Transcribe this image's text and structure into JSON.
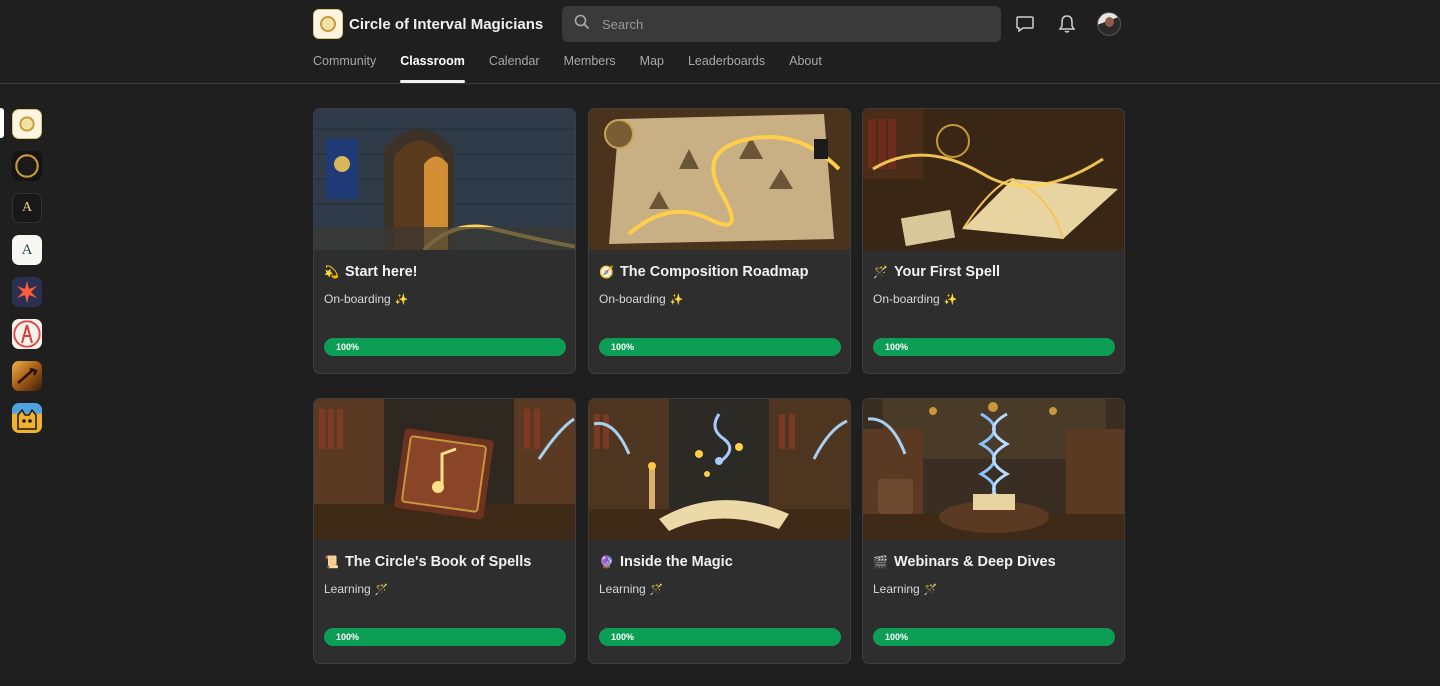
{
  "app": {
    "community_name": "Circle of Interval Magicians",
    "search_placeholder": "Search"
  },
  "tabs": [
    {
      "label": "Community",
      "active": false
    },
    {
      "label": "Classroom",
      "active": true
    },
    {
      "label": "Calendar",
      "active": false
    },
    {
      "label": "Members",
      "active": false
    },
    {
      "label": "Map",
      "active": false
    },
    {
      "label": "Leaderboards",
      "active": false
    },
    {
      "label": "About",
      "active": false
    }
  ],
  "sidebar": {
    "items": [
      {
        "icon": "interval-magicians-logo",
        "label": "",
        "selected": true
      },
      {
        "icon": "treble-clef-logo",
        "label": ""
      },
      {
        "icon": "letter-a-dark-logo",
        "label": "A"
      },
      {
        "icon": "letter-a-light-logo",
        "label": "A"
      },
      {
        "icon": "star-burst-logo",
        "label": ""
      },
      {
        "icon": "red-emblem-logo",
        "label": ""
      },
      {
        "icon": "orange-guitar-logo",
        "label": ""
      },
      {
        "icon": "cat-logo",
        "label": ""
      }
    ]
  },
  "courses": [
    {
      "emoji": "💫",
      "title": "Start here!",
      "subtitle": "On-boarding",
      "subtitle_emoji": "✨",
      "progress_label": "100%",
      "progress": 100
    },
    {
      "emoji": "🧭",
      "title": "The Composition Roadmap",
      "subtitle": "On-boarding",
      "subtitle_emoji": "✨",
      "progress_label": "100%",
      "progress": 100
    },
    {
      "emoji": "🪄",
      "title": "Your First Spell",
      "subtitle": "On-boarding",
      "subtitle_emoji": "✨",
      "progress_label": "100%",
      "progress": 100
    },
    {
      "emoji": "📜",
      "title": "The Circle's Book of Spells",
      "subtitle": "Learning",
      "subtitle_emoji": "🪄",
      "progress_label": "100%",
      "progress": 100
    },
    {
      "emoji": "🔮",
      "title": "Inside the Magic",
      "subtitle": "Learning",
      "subtitle_emoji": "🪄",
      "progress_label": "100%",
      "progress": 100
    },
    {
      "emoji": "🎬",
      "title": "Webinars & Deep Dives",
      "subtitle": "Learning",
      "subtitle_emoji": "🪄",
      "progress_label": "100%",
      "progress": 100
    }
  ],
  "colors": {
    "background": "#1f1f1f",
    "card": "#2e2e2e",
    "progress": "#0d9e55"
  }
}
